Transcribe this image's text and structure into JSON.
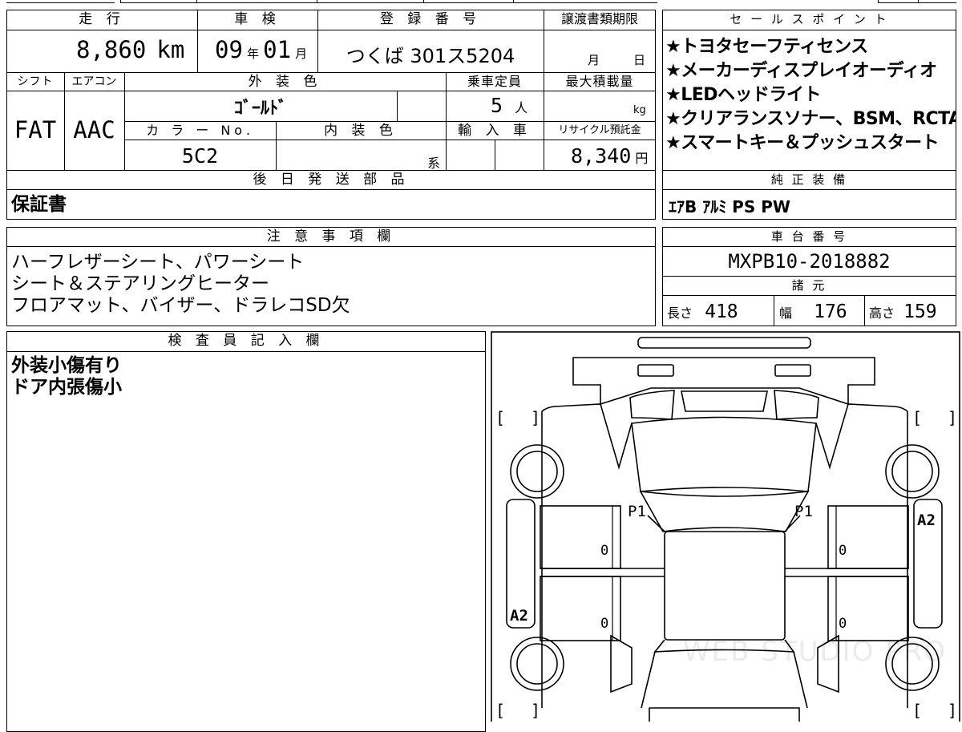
{
  "sheet": {
    "mileage": {
      "header": "走 行",
      "value": "8,860",
      "unit": "km"
    },
    "inspection": {
      "header": "車 検",
      "year": "09",
      "year_unit": "年",
      "month": "01",
      "month_unit": "月"
    },
    "registration": {
      "header": "登 録 番 号",
      "value": "つくば 301ス5204"
    },
    "transfer_deadline": {
      "header": "譲渡書類期限",
      "month_unit": "月",
      "day_unit": "日"
    },
    "shift": {
      "header": "シフト",
      "value": "FAT"
    },
    "aircon": {
      "header": "エアコン",
      "value": "AAC"
    },
    "exterior_color": {
      "header": "外 装 色",
      "value": "ｺﾞｰﾙﾄﾞ"
    },
    "capacity": {
      "header": "乗車定員",
      "value": "5",
      "unit": "人"
    },
    "max_load": {
      "header": "最大積載量",
      "unit": "kg"
    },
    "color_no": {
      "header": "カ ラ ー No.",
      "value": "5C2"
    },
    "interior_color": {
      "header": "内 装 色",
      "suffix": "系"
    },
    "import": {
      "header": "輸 入 車"
    },
    "recycle": {
      "header": "リサイクル預託金",
      "value": "8,340",
      "unit": "円"
    },
    "later_parts": {
      "header": "後 日 発 送 部 品",
      "value": "保証書"
    },
    "notes": {
      "header": "注 意 事 項 欄",
      "lines": [
        "ハーフレザーシート、パワーシート",
        "シート＆ステアリングヒーター",
        "フロアマット、バイザー、ドラレコSD欠"
      ]
    },
    "inspector": {
      "header": "検 査 員 記 入 欄",
      "lines": [
        "外装小傷有り",
        "ドア内張傷小"
      ]
    }
  },
  "sales_points": {
    "header": "セ ー ル ス ポ イ ン ト",
    "items": [
      "★トヨタセーフティセンス",
      "★メーカーディスプレイオーディオ",
      "★LEDヘッドライト",
      "★クリアランスソナー、BSM、RCTA",
      "★スマートキー＆プッシュスタート"
    ]
  },
  "genuine_equipment": {
    "header": "純 正 装 備",
    "value": "ｴｱB ｱﾙﾐ PS PW"
  },
  "chassis": {
    "header": "車 台 番 号",
    "value": "MXPB10-2018882"
  },
  "specs": {
    "header": "諸 元",
    "length": {
      "label": "長さ",
      "value": "418"
    },
    "width": {
      "label": "幅",
      "value": "176"
    },
    "height": {
      "label": "高さ",
      "value": "159"
    }
  },
  "diagram": {
    "marks": {
      "front_left_a": "P1",
      "front_right_a": "P1",
      "right_side": "A2",
      "left_side": "A2",
      "door_fl": "0",
      "door_rl": "0",
      "door_fr": "0",
      "door_rr": "0"
    },
    "bracket_open": "[",
    "bracket_close": "]",
    "watermark": "WEB STUDIO PRO"
  }
}
